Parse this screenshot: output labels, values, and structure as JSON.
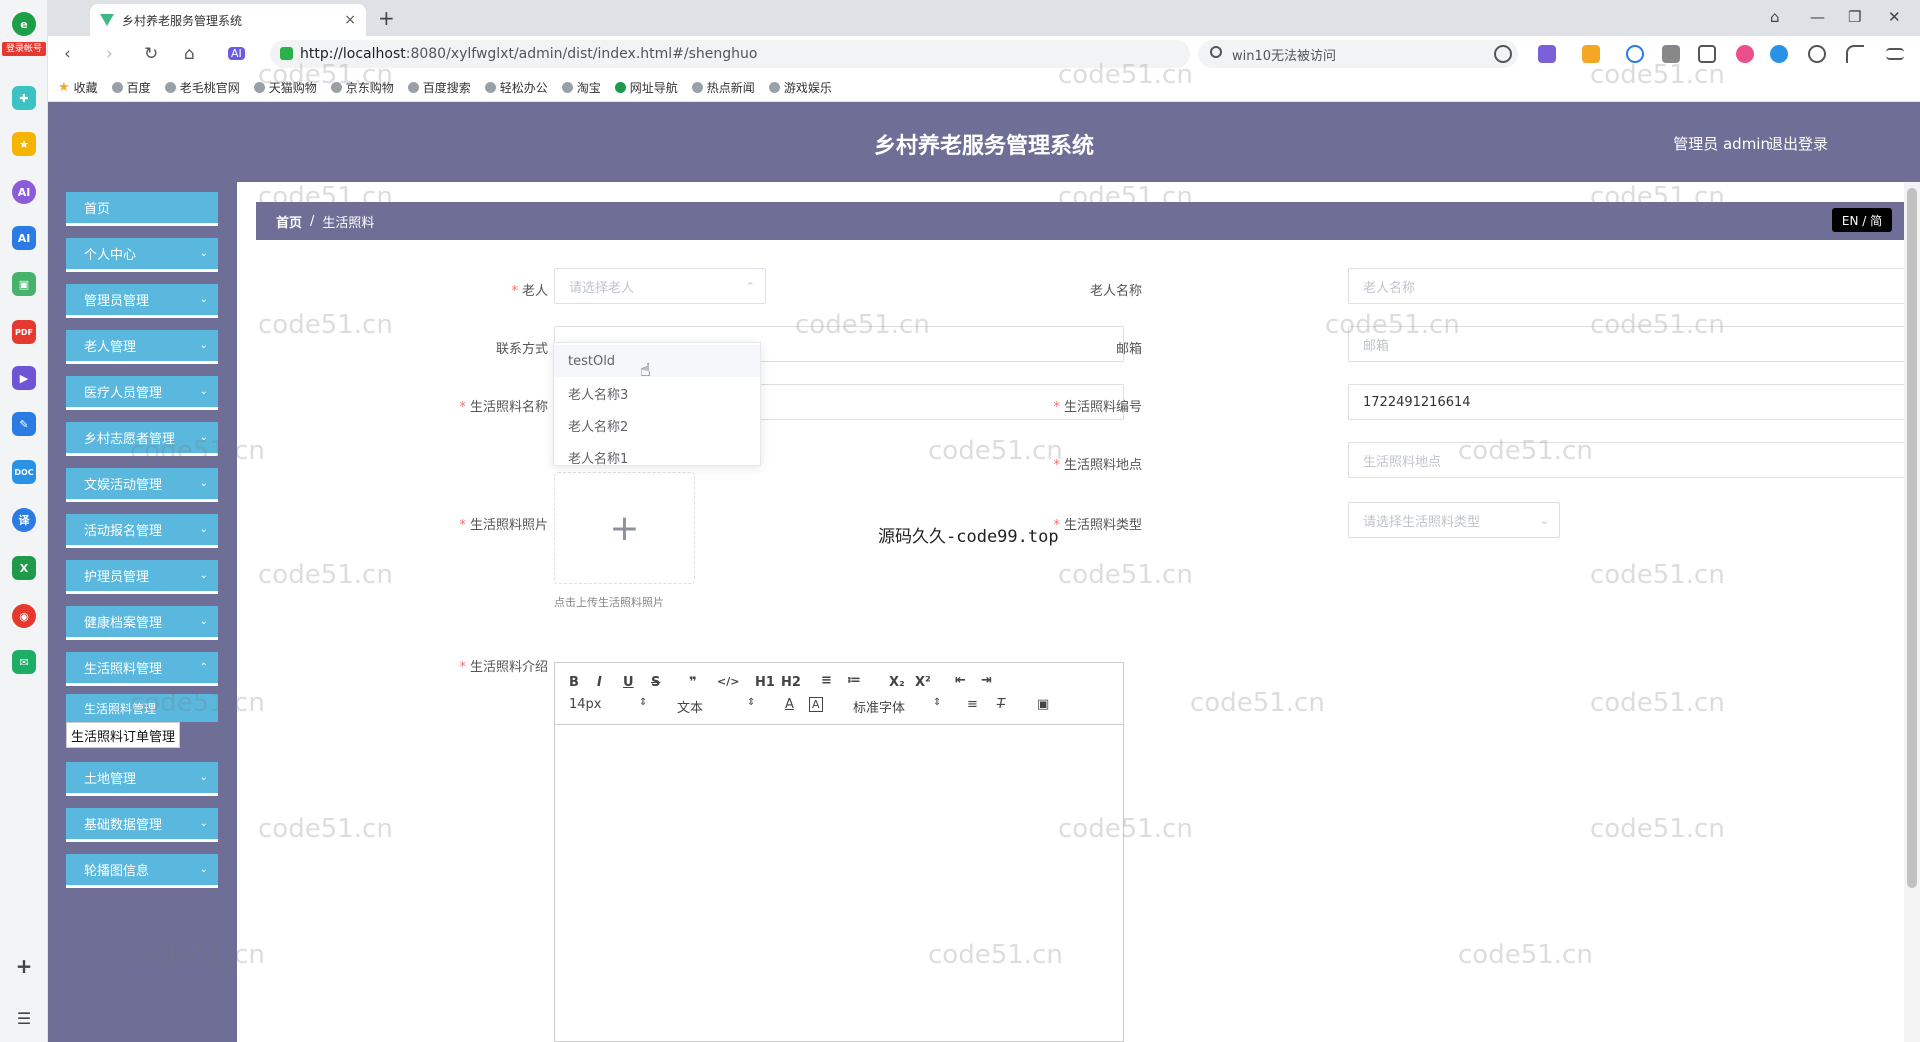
{
  "browser": {
    "tab_title": "乡村养老服务管理系统",
    "url_host": "http://localhost",
    "url_rest": ":8080/xylfwglxt/admin/dist/index.html#/shenghuo",
    "search_text": "win10无法被访问",
    "login_badge": "登录帐号",
    "new_tab": "+",
    "tab_close": "×",
    "bookmarks": [
      "收藏",
      "百度",
      "老毛桃官网",
      "天猫购物",
      "京东购物",
      "百度搜索",
      "轻松办公",
      "淘宝",
      "网址导航",
      "热点新闻",
      "游戏娱乐"
    ]
  },
  "header": {
    "title": "乡村养老服务管理系统",
    "user": "管理员 admin",
    "logout": "退出登录"
  },
  "sidebar": {
    "items": [
      "首页",
      "个人中心",
      "管理员管理",
      "老人管理",
      "医疗人员管理",
      "乡村志愿者管理",
      "文娱活动管理",
      "活动报名管理",
      "护理员管理",
      "健康档案管理",
      "生活照料管理",
      "土地管理",
      "基础数据管理",
      "轮播图信息"
    ],
    "sub_item": "生活照料管理",
    "tooltip": "生活照料订单管理"
  },
  "breadcrumb": {
    "home": "首页",
    "sep": "/",
    "current": "生活照料"
  },
  "lang_switch": "EN / 简",
  "form": {
    "elder_label": "老人",
    "elder_placeholder": "请选择老人",
    "elder_name_label": "老人名称",
    "elder_name_placeholder": "老人名称",
    "contact_label": "联系方式",
    "email_label": "邮箱",
    "email_placeholder": "邮箱",
    "care_name_label": "生活照料名称",
    "care_no_label": "生活照料编号",
    "care_no_value": "1722491216614",
    "care_place_label": "生活照料地点",
    "care_place_placeholder": "生活照料地点",
    "care_photo_label": "生活照料照片",
    "upload_tip": "点击上传生活照料照片",
    "care_type_label": "生活照料类型",
    "care_type_placeholder": "请选择生活照料类型",
    "care_intro_label": "生活照料介绍"
  },
  "dropdown": {
    "options": [
      "testOld",
      "老人名称3",
      "老人名称2",
      "老人名称1"
    ]
  },
  "editor": {
    "buttons": [
      "B",
      "I",
      "U",
      "S",
      "❞",
      "</>",
      "H1",
      "H2",
      "≡",
      "≔",
      "X₂",
      "X²",
      "⇤",
      "⇥"
    ],
    "font_size": "14px",
    "heading": "文本",
    "font_family": "标准字体"
  },
  "center_watermark": "源码久久-code99.top",
  "watermark": "code51.cn",
  "colors": {
    "header_bg": "#6e6e97",
    "menu_bg": "#5ab8df",
    "required": "#f56c6c"
  }
}
